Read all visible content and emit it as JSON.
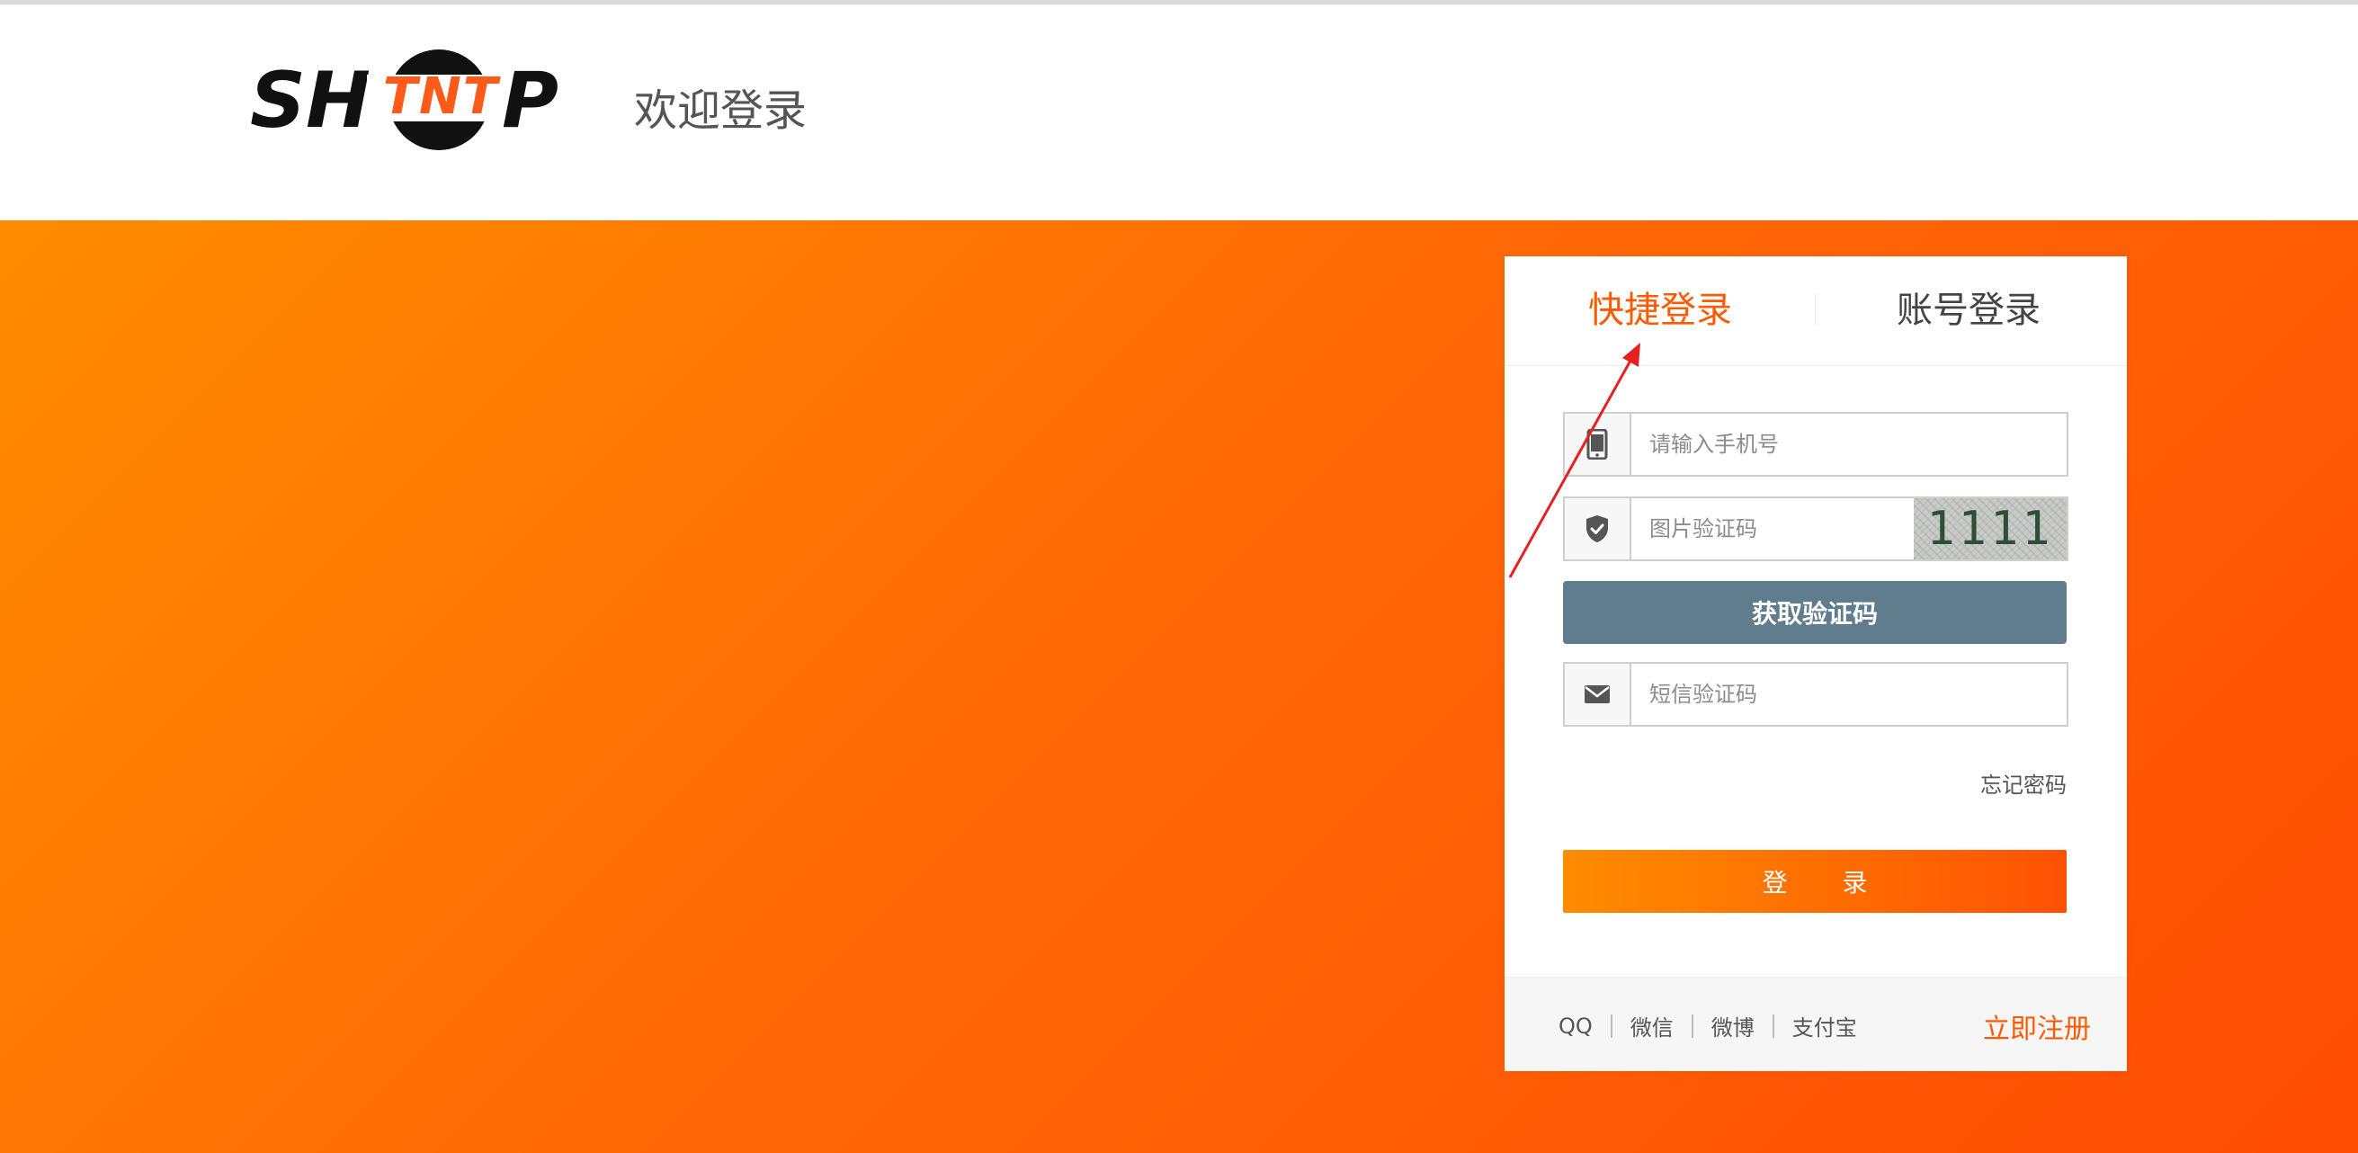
{
  "header": {
    "logo_left": "SH",
    "logo_middle": "TNT",
    "logo_right": "P",
    "welcome": "欢迎登录"
  },
  "tabs": {
    "quick_login": "快捷登录",
    "account_login": "账号登录"
  },
  "form": {
    "phone_placeholder": "请输入手机号",
    "captcha_placeholder": "图片验证码",
    "captcha_code": "1111",
    "get_code_label": "获取验证码",
    "sms_placeholder": "短信验证码",
    "forgot_password": "忘记密码",
    "login_label": "登 录"
  },
  "footer": {
    "social": [
      "QQ",
      "微信",
      "微博",
      "支付宝"
    ],
    "register": "立即注册"
  },
  "colors": {
    "accent": "#ff5a00",
    "banner_start": "#ff8c00",
    "banner_end": "#ff4d04",
    "get_code_button": "#5f7d8c",
    "annotation_arrow": "#e52020"
  },
  "icons": {
    "phone": "mobile-phone-icon",
    "captcha": "shield-check-icon",
    "sms": "envelope-icon"
  }
}
